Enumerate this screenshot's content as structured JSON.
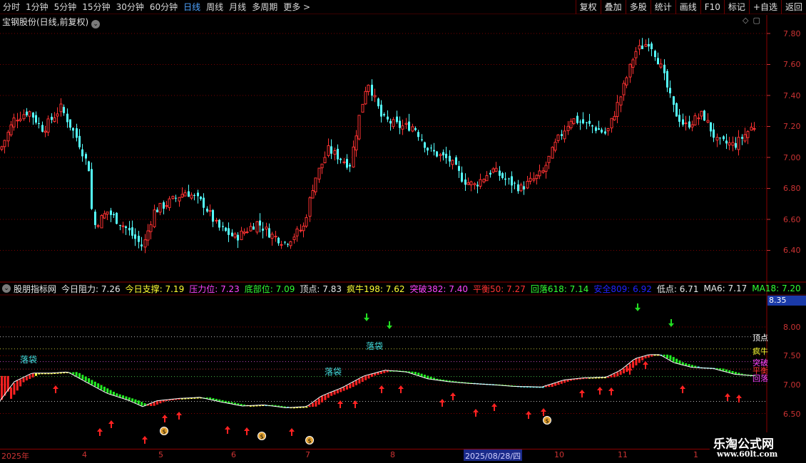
{
  "toolbar": {
    "periods": [
      "分时",
      "1分钟",
      "5分钟",
      "15分钟",
      "30分钟",
      "60分钟",
      "日线",
      "周线",
      "月线",
      "多周期",
      "更多 >"
    ],
    "active_period": "日线",
    "buttons": [
      "复权",
      "叠加",
      "多股",
      "统计",
      "画线",
      "F10",
      "标记",
      "+自选",
      "返回"
    ]
  },
  "main_chart": {
    "title": "宝钢股份(日线,前复权)",
    "y_ticks": [
      "7.80",
      "7.60",
      "7.40",
      "7.20",
      "7.00",
      "6.80",
      "6.60",
      "6.40"
    ]
  },
  "indicator": {
    "name": "股朋指标网",
    "items": [
      {
        "label": "今日阻力:",
        "value": "7.26",
        "color": "#e8e8e8"
      },
      {
        "label": "今日支撑:",
        "value": "7.19",
        "color": "#ffff33"
      },
      {
        "label": "压力位:",
        "value": "7.23",
        "color": "#ff44ff"
      },
      {
        "label": "底部位:",
        "value": "7.09",
        "color": "#33ff33"
      },
      {
        "label": "顶点:",
        "value": "7.83",
        "color": "#e8e8e8"
      },
      {
        "label": "疯牛198:",
        "value": "7.62",
        "color": "#ffff33"
      },
      {
        "label": "突破382:",
        "value": "7.40",
        "color": "#ff44ff"
      },
      {
        "label": "平衡50:",
        "value": "7.27",
        "color": "#ff3333"
      },
      {
        "label": "回落618:",
        "value": "7.14",
        "color": "#33ff33"
      },
      {
        "label": "安全809:",
        "value": "6.92",
        "color": "#2222ff"
      },
      {
        "label": "低点:",
        "value": "6.71",
        "color": "#e8e8e8"
      },
      {
        "label": "MA6:",
        "value": "7.17",
        "color": "#e8e8e8"
      },
      {
        "label": "MA18:",
        "value": "7.20",
        "color": "#33ff33"
      }
    ],
    "y_ticks": [
      "8.00",
      "7.50",
      "7.00",
      "6.50"
    ],
    "current_value_box": "8.35",
    "right_labels": [
      {
        "text": "顶点",
        "color": "#ffffff"
      },
      {
        "text": "疯牛",
        "color": "#ffff33"
      },
      {
        "text": "突破",
        "color": "#ff44ff"
      },
      {
        "text": "平衡",
        "color": "#ff3333"
      },
      {
        "text": "回落",
        "color": "#ff44ff"
      }
    ],
    "annotations": [
      "落袋",
      "落袋",
      "落袋"
    ]
  },
  "date_axis": {
    "ticks": [
      "2025年",
      "4",
      "5",
      "6",
      "7",
      "8",
      "10",
      "11",
      "1"
    ],
    "cursor_date": "2025/08/28/四"
  },
  "brand": {
    "name": "乐淘公式网",
    "url": "www.60lt.com"
  },
  "colors": {
    "up": "#ff3232",
    "down": "#54ffff",
    "grid": "#8a0000"
  }
}
